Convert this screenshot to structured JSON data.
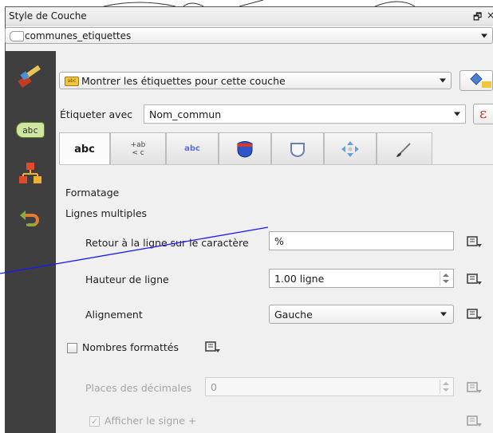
{
  "dock": {
    "title": "Style de Couche",
    "float_glyph": "🗗",
    "close_glyph": "×"
  },
  "layer": {
    "name": "communes_etiquettes",
    "icon": "line-layer-icon"
  },
  "sidebar": {
    "items": [
      {
        "icon": "symbology-brush-icon"
      },
      {
        "icon": "labels-abc-icon",
        "badge_text": "abc",
        "active": true
      },
      {
        "icon": "diagrams-icon"
      },
      {
        "icon": "history-undo-icon"
      }
    ]
  },
  "labeling": {
    "mode_label": "Montrer les étiquettes pour cette couche",
    "mode_icon_text": "abc",
    "label_with": "Étiqueter avec",
    "field_value": "Nom_commun",
    "expression_glyph": "ε"
  },
  "tabs": [
    {
      "name": "text",
      "label": "abc",
      "active": true
    },
    {
      "name": "formatting",
      "label_top": "+ab",
      "label_bottom": "< c"
    },
    {
      "name": "buffer",
      "label": "abc"
    },
    {
      "name": "background"
    },
    {
      "name": "shadow"
    },
    {
      "name": "placement"
    },
    {
      "name": "rendering"
    }
  ],
  "formatting": {
    "section_title": "Formatage",
    "subsection_title": "Lignes multiples",
    "wrap_label": "Retour à la ligne sur le caractère",
    "wrap_value": "%",
    "line_height_label": "Hauteur de ligne",
    "line_height_value": "1.00 ligne",
    "alignment_label": "Alignement",
    "alignment_value": "Gauche",
    "formatted_numbers_label": "Nombres formattés",
    "formatted_numbers_checked": false,
    "decimals_label": "Places des décimales",
    "decimals_value": "0",
    "plus_sign_label": "Afficher le signe +",
    "plus_sign_checked": true
  },
  "colors": {
    "accent_line": "#1a1aff",
    "sidebar_bg": "#3f3f3f",
    "label_badge": "#cfe6a3"
  }
}
